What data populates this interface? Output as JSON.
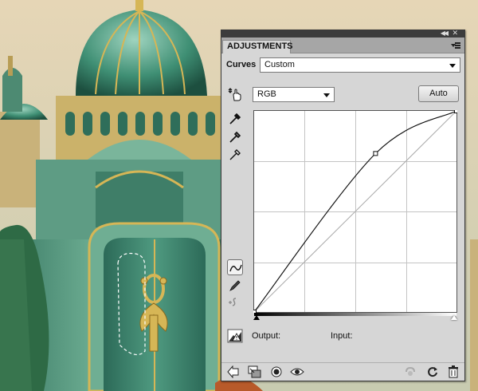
{
  "panel": {
    "tab_label": "ADJUSTMENTS",
    "title": "Curves",
    "preset_value": "Custom",
    "channel_value": "RGB",
    "auto_label": "Auto",
    "output_label": "Output:",
    "input_label": "Input:"
  },
  "curve": {
    "input_range": [
      0,
      255
    ],
    "output_range": [
      0,
      255
    ],
    "points": [
      [
        0,
        0
      ],
      [
        153,
        201
      ],
      [
        255,
        255
      ]
    ]
  },
  "colors": {
    "panel_bg": "#d6d6d6",
    "dome_green": "#3c8a70",
    "gold": "#d6b656"
  }
}
